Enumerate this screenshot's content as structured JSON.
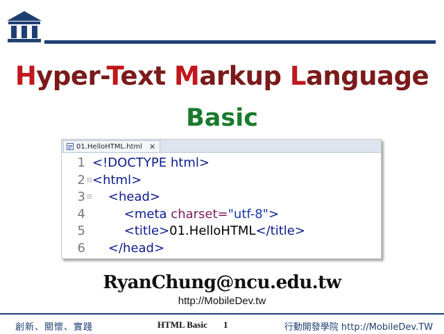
{
  "slide": {
    "title_parts": [
      {
        "cap": "H",
        "rest": "yper-"
      },
      {
        "cap": "T",
        "rest": "ext "
      },
      {
        "cap": "M",
        "rest": "arkup "
      },
      {
        "cap": "L",
        "rest": "anguage"
      }
    ],
    "subtitle": "Basic",
    "email": "RyanChung@ncu.edu.tw",
    "url": "http://MobileDev.tw"
  },
  "editor": {
    "tab_label": "01.HelloHTML.html",
    "tab_close": "✕",
    "lines": [
      {
        "num": "1",
        "fold": "",
        "code": "<!DOCTYPE html>"
      },
      {
        "num": "2",
        "fold": "⊟",
        "code": "<html>"
      },
      {
        "num": "3",
        "fold": "⊟",
        "code": "    <head>"
      },
      {
        "num": "4",
        "fold": "",
        "code": "        <meta charset=\"utf-8\">"
      },
      {
        "num": "5",
        "fold": "",
        "code": "        <title>01.HelloHTML</title>"
      },
      {
        "num": "6",
        "fold": "",
        "code": "    </head>"
      }
    ]
  },
  "footer": {
    "slogan": "創新、關懷、實踐",
    "course": "HTML Basic",
    "page": "1",
    "institute": "行動開發學院 http://MobileDev.TW"
  },
  "colors": {
    "brand_navy": "#1f3f73",
    "title_red": "#c0181d",
    "title_dark": "#7a1a1a",
    "subtitle_green": "#1a7a2c"
  },
  "icons": {
    "logo": "institute-columns-logo",
    "tab": "html-file-icon"
  }
}
